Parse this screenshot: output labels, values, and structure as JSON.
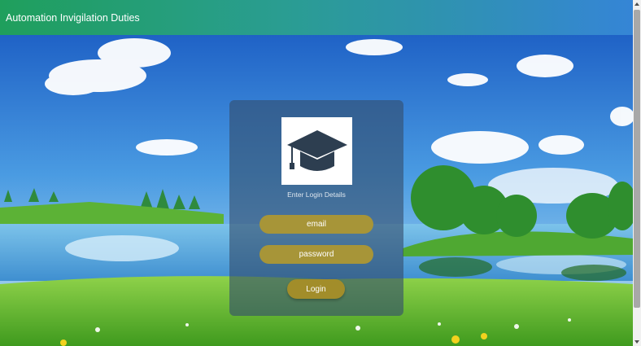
{
  "navbar": {
    "title": "Automation Invigilation Duties"
  },
  "login_card": {
    "logo_icon": "graduation-cap-icon",
    "subtitle": "Enter Login Details",
    "email_placeholder": "email",
    "password_placeholder": "password",
    "login_label": "Login"
  },
  "colors": {
    "navbar_gradient_start": "#1f9f5c",
    "navbar_gradient_end": "#3585d6",
    "field_background": "#a79538",
    "button_background": "#a28d2a",
    "card_background": "#344e6c"
  }
}
